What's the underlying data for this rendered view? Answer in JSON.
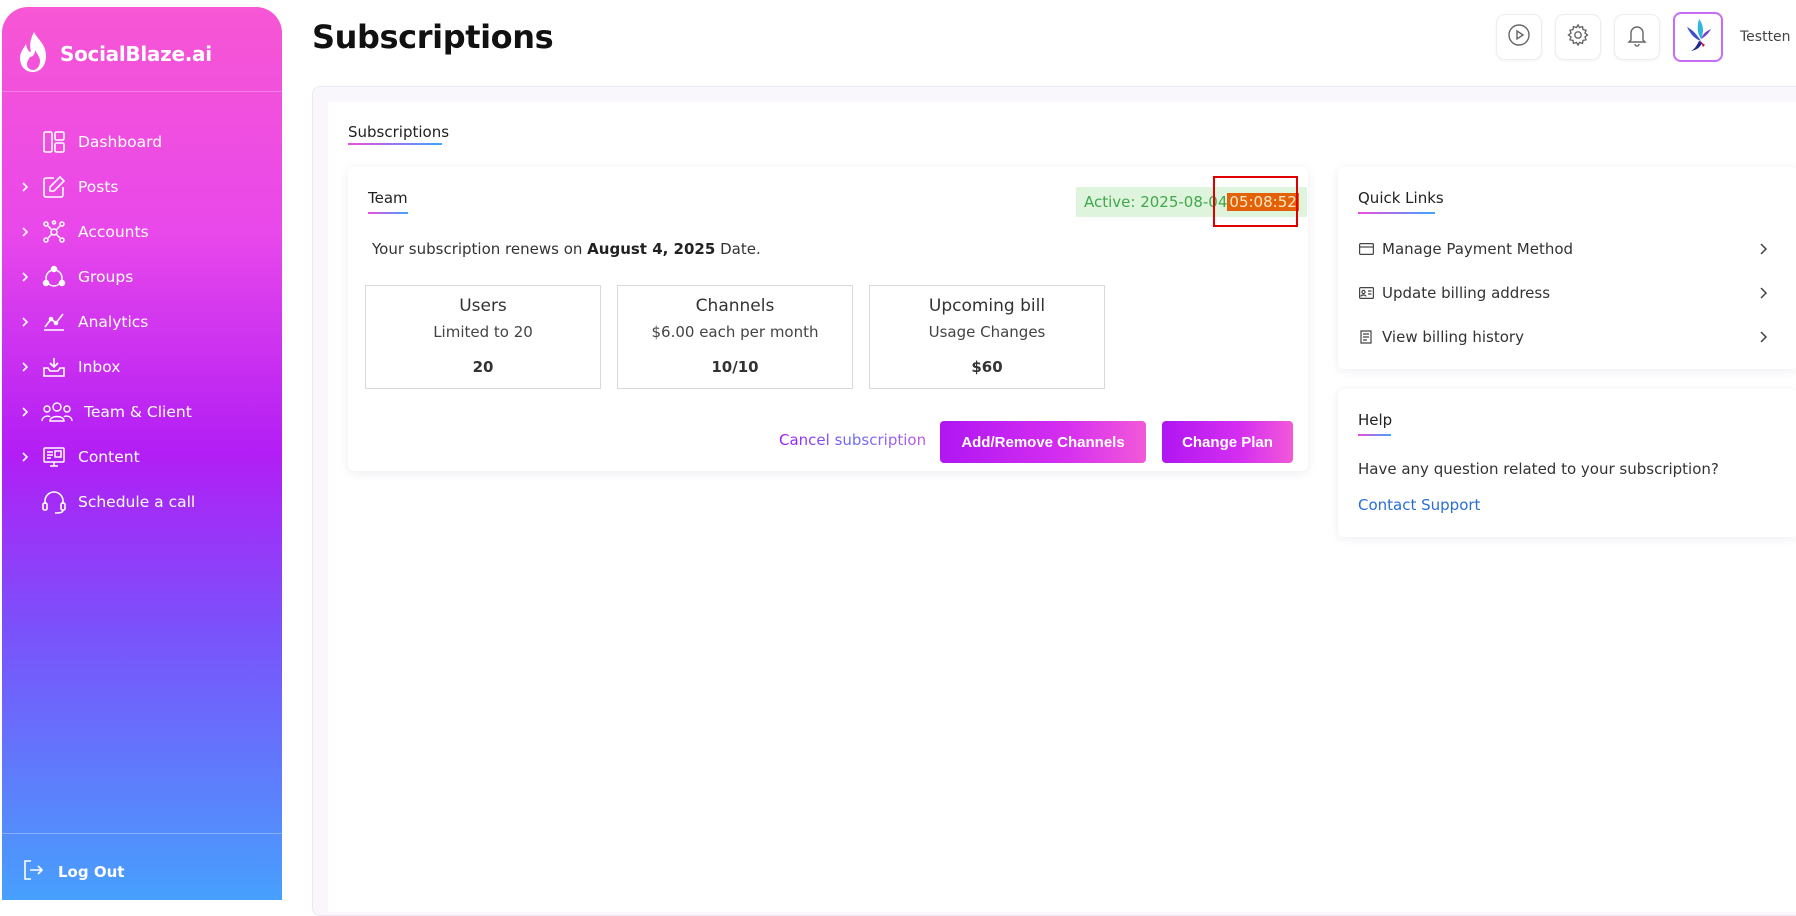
{
  "app": {
    "brand": "SocialBlaze.ai",
    "page_title": "Subscriptions",
    "user_name": "Testten"
  },
  "sidebar": {
    "items": [
      {
        "label": "Dashboard",
        "icon": "dashboard-icon",
        "expandable": false
      },
      {
        "label": "Posts",
        "icon": "edit-icon",
        "expandable": true
      },
      {
        "label": "Accounts",
        "icon": "network-icon",
        "expandable": true
      },
      {
        "label": "Groups",
        "icon": "groups-icon",
        "expandable": true
      },
      {
        "label": "Analytics",
        "icon": "analytics-icon",
        "expandable": true
      },
      {
        "label": "Inbox",
        "icon": "inbox-icon",
        "expandable": true
      },
      {
        "label": "Team & Client",
        "icon": "team-icon",
        "expandable": true
      },
      {
        "label": "Content",
        "icon": "content-icon",
        "expandable": true
      },
      {
        "label": "Schedule a call",
        "icon": "headset-icon",
        "expandable": false
      }
    ],
    "logout_label": "Log Out"
  },
  "tabs": {
    "subscriptions": "Subscriptions"
  },
  "team_card": {
    "title": "Team",
    "active_prefix": "Active: 2025-08-04",
    "active_time": "05:08:52",
    "renew_prefix": "Your subscription renews on",
    "renew_date": "August 4, 2025",
    "renew_suffix": "Date.",
    "stats": [
      {
        "title": "Users",
        "subtitle": "Limited to 20",
        "value": "20"
      },
      {
        "title": "Channels",
        "subtitle": "$6.00 each per month",
        "value": "10/10"
      },
      {
        "title": "Upcoming bill",
        "subtitle": "Usage Changes",
        "value": "$60"
      }
    ],
    "cancel_label": "Cancel subscription",
    "add_remove_label": "Add/Remove Channels",
    "change_plan_label": "Change Plan"
  },
  "quick_links": {
    "title": "Quick Links",
    "items": [
      {
        "label": "Manage Payment Method",
        "icon": "credit-card-icon"
      },
      {
        "label": "Update billing address",
        "icon": "id-card-icon"
      },
      {
        "label": "View billing history",
        "icon": "receipt-icon"
      }
    ]
  },
  "help": {
    "title": "Help",
    "question": "Have any question related to your subscription?",
    "contact_label": "Contact Support"
  },
  "colors": {
    "accent_start": "#b016f2",
    "accent_end": "#f259d8",
    "active_bg": "#dff4dd",
    "active_text": "#3fa84b",
    "highlight_time": "#e36209",
    "link_blue": "#2a6ed4"
  }
}
